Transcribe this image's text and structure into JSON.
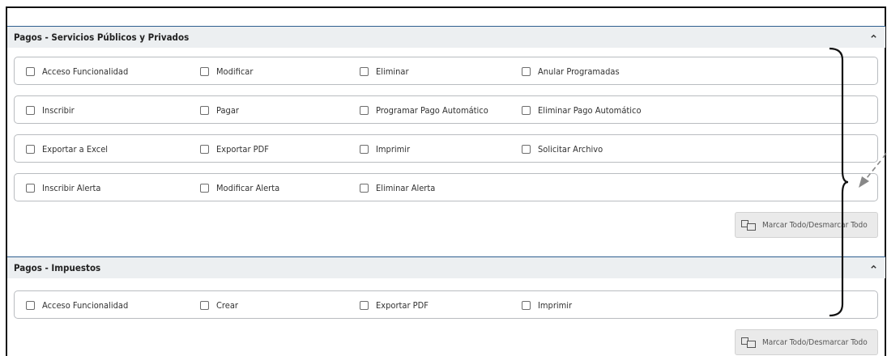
{
  "sections": [
    {
      "title": "Pagos - Servicios Públicos y Privados",
      "rows": [
        [
          "Acceso Funcionalidad",
          "Modificar",
          "Eliminar",
          "Anular Programadas"
        ],
        [
          "Inscribir",
          "Pagar",
          "Programar Pago Automático",
          "Eliminar Pago Automático"
        ],
        [
          "Exportar a Excel",
          "Exportar PDF",
          "Imprimir",
          "Solicitar Archivo"
        ],
        [
          "Inscribir Alerta",
          "Modificar Alerta",
          "Eliminar Alerta"
        ]
      ],
      "toggle_all_label": "Marcar Todo/Desmarcar Todo"
    },
    {
      "title": "Pagos - Impuestos",
      "rows": [
        [
          "Acceso Funcionalidad",
          "Crear",
          "Exportar PDF",
          "Imprimir"
        ]
      ],
      "toggle_all_label": "Marcar Todo/Desmarcar Todo"
    }
  ],
  "icons": {
    "collapse": "chevron-up-icon",
    "toggle_all": "double-checkbox-icon"
  },
  "colors": {
    "section_border": "#2f5f8f",
    "header_bg": "#eceff1",
    "annotation": "#888888"
  }
}
